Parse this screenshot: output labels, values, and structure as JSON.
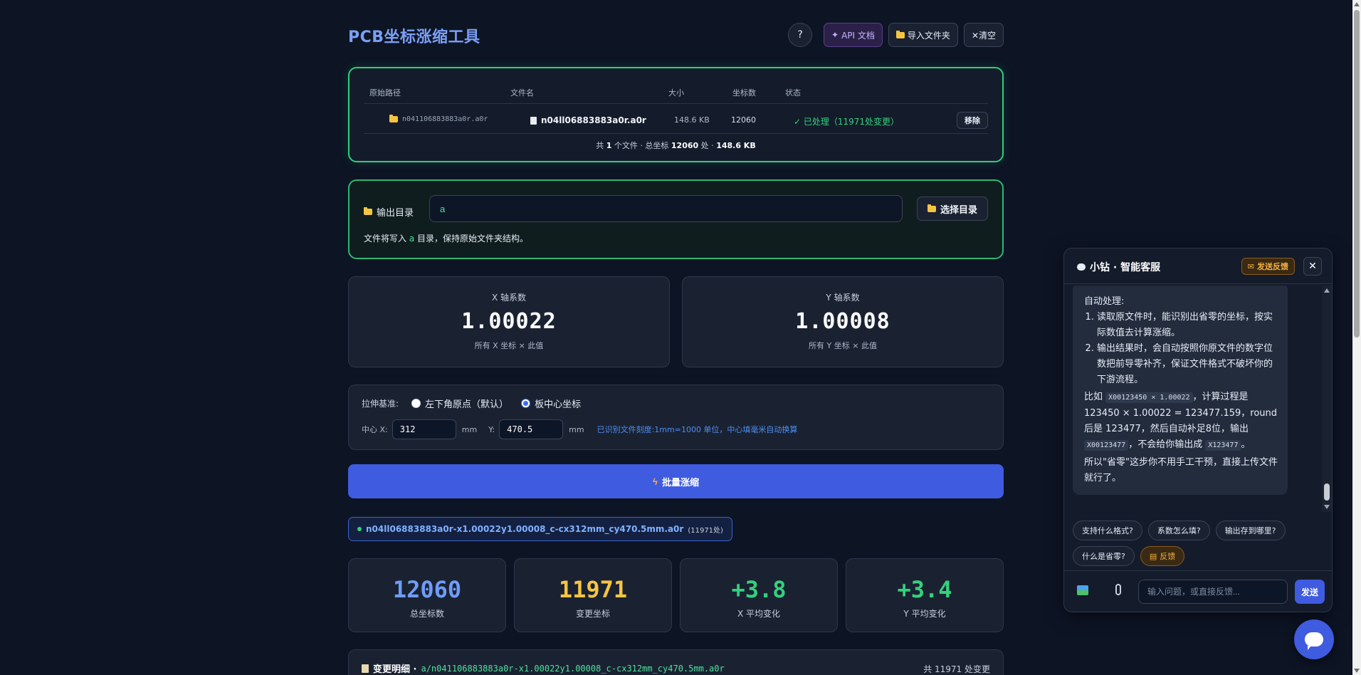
{
  "app": {
    "title": "PCB坐标涨缩工具"
  },
  "header": {
    "help_label": "?",
    "api_label": "API 文档",
    "import_label": "导入文件夹",
    "clear_label": "✕清空"
  },
  "files": {
    "columns": [
      "原始路径",
      "文件名",
      "大小",
      "坐标数",
      "状态"
    ],
    "rows": [
      {
        "path": "n041106883883a0r.a0r",
        "name": "n04ll06883883a0r.a0r",
        "size": "148.6 KB",
        "count": "12060",
        "status": "✓ 已处理（11971处变更）",
        "action": "移除"
      }
    ],
    "summary_prefix": "共 ",
    "summary_files": "1",
    "summary_mid": " 个文件 · 总坐标 ",
    "summary_coords": "12060",
    "summary_mid2": " 处 · ",
    "summary_size": "148.6 KB"
  },
  "output": {
    "label": "输出目录",
    "value": "a",
    "button": "选择目录",
    "note_prefix": "文件将写入 ",
    "note_dir": "a",
    "note_suffix": " 目录，保持原始文件夹结构。"
  },
  "coefficients": {
    "x": {
      "label": "X 轴系数",
      "value": "1.00022",
      "sub": "所有 X 坐标 × 此值"
    },
    "y": {
      "label": "Y 轴系数",
      "value": "1.00008",
      "sub": "所有 Y 坐标 × 此值"
    }
  },
  "base": {
    "label": "拉伸基准:",
    "options": [
      "左下角原点（默认）",
      "板中心坐标"
    ],
    "selected": "板中心坐标",
    "center_x_label": "中心 X:",
    "center_x": "312",
    "center_y_label": "Y:",
    "center_y": "470.5",
    "unit": "mm",
    "hint": "已识别文件刻度:1mm=1000 单位，中心填毫米自动换算"
  },
  "run": {
    "label": "批量涨缩"
  },
  "result": {
    "filename": "n04ll06883883a0r-x1.00022y1.00008_c-cx312mm_cy470.5mm.a0r",
    "count": "(11971处)"
  },
  "stats": [
    {
      "value": "12060",
      "label": "总坐标数",
      "color": "#6f9cf6"
    },
    {
      "value": "11971",
      "label": "变更坐标",
      "color": "#f5c542"
    },
    {
      "value": "+3.8",
      "label": "X 平均变化",
      "color": "#34d17c"
    },
    {
      "value": "+3.4",
      "label": "Y 平均变化",
      "color": "#34d17c"
    }
  ],
  "changes": {
    "title": "变更明细 · ",
    "path": "a/n041106883883a0r-x1.00022y1.00008_c-cx312mm_cy470.5mm.a0r",
    "total": "共 11971 处变更"
  },
  "chat": {
    "title": "小钻 · 智能客服",
    "feedback_label": "发送反馈",
    "message": {
      "heading": "自动处理:",
      "items": [
        "读取原文件时，能识别出省零的坐标，按实际数值去计算涨缩。",
        "输出结果时，会自动按照你原文件的数字位数把前导零补齐，保证文件格式不破坏你的下游流程。"
      ],
      "example_prefix": "比如 ",
      "example_code1": "X00123450 × 1.00022",
      "example_mid": "，计算过程是 123450 × 1.00022 = 123477.159，round 后是 123477，然后自动补足8位，输出 ",
      "example_code2": "X00123477",
      "example_mid2": "，不会给你输出成 ",
      "example_code3": "X123477",
      "example_end": "。",
      "closing": "所以\"省零\"这步你不用手工干预，直接上传文件就行了。"
    },
    "chips": [
      "支持什么格式?",
      "系数怎么填?",
      "输出存到哪里?",
      "什么是省零?",
      "反馈"
    ],
    "input_placeholder": "输入问题，或直接反馈...",
    "send_label": "发送"
  },
  "colors": {
    "accent": "#3f5be0",
    "success": "#34d17c",
    "brand_title": "#7b9ff5",
    "warning": "#f5c542"
  }
}
